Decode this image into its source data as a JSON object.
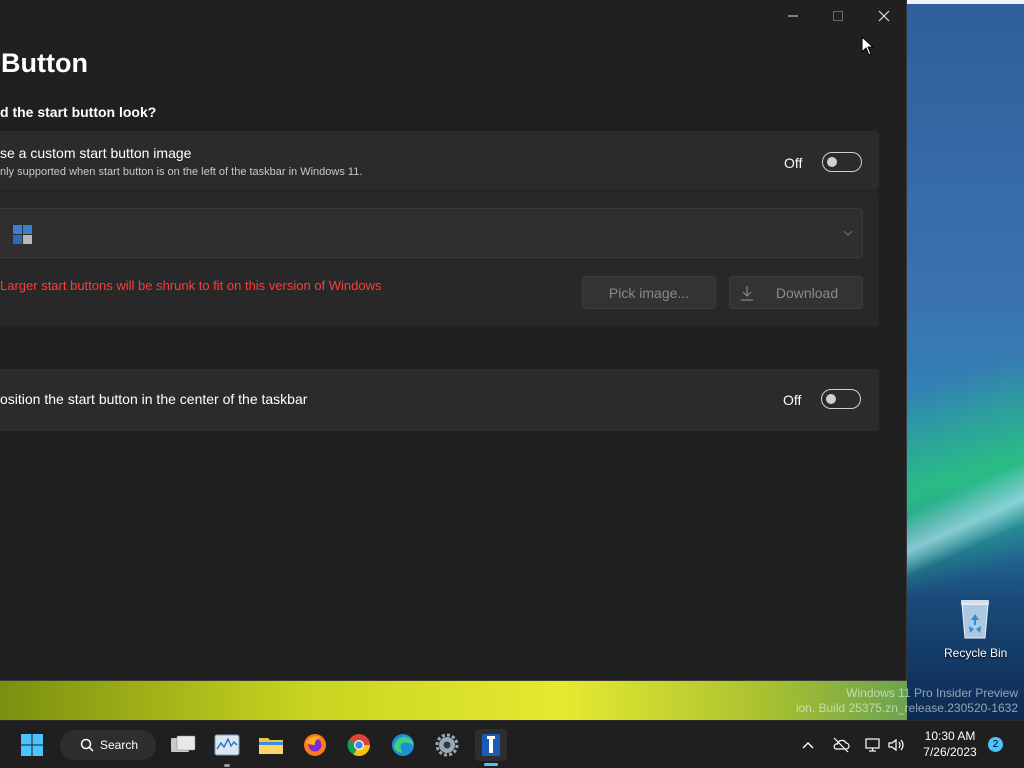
{
  "window": {
    "title": "Button",
    "section_heading": "d the start button look?"
  },
  "custom_image_option": {
    "title": "se a custom start button image",
    "subtitle": "nly supported when start button is on the left of the taskbar in Windows 11.",
    "toggle_state": "Off"
  },
  "image_picker": {
    "warning": "Larger start buttons will be shrunk to fit on this version of Windows",
    "pick_button_label": "Pick image...",
    "download_button_label": "Download",
    "warning_color": "#ff3b3b"
  },
  "center_option": {
    "title": "osition the start button in the center of the taskbar",
    "toggle_state": "Off"
  },
  "desktop": {
    "recycle_bin_label": "Recycle Bin",
    "watermark_line1": "Windows 11 Pro Insider Preview",
    "watermark_line2": "ion. Build 25375.zn_release.230520-1632"
  },
  "taskbar": {
    "search_label": "Search",
    "time": "10:30 AM",
    "date": "7/26/2023",
    "notification_count": "2",
    "accent_color": "#4cc2ff",
    "pinned_apps": [
      "task-view",
      "resource-monitor",
      "file-explorer",
      "firefox",
      "chrome",
      "edge",
      "settings",
      "start-button-tool"
    ]
  }
}
